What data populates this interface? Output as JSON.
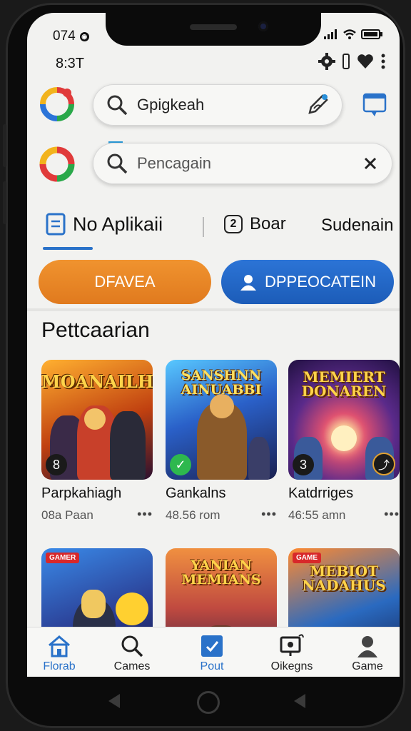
{
  "status_bar": {
    "carrier": "074",
    "time": "8:3T"
  },
  "search": {
    "primary_value": "Gpigkeah",
    "secondary_placeholder": "Pencagain"
  },
  "tabs": [
    {
      "label": "No Aplikaii",
      "active": true
    },
    {
      "label": "Boar",
      "badge": "2"
    },
    {
      "label": "Sudenain"
    }
  ],
  "actions": {
    "left_label": "DFAVEA",
    "right_label": "DPPEOCATEIN"
  },
  "section": {
    "title": "Pettcaarian"
  },
  "cards_row1": [
    {
      "art_title": "MOANAILH",
      "name": "Parpkahiagh",
      "meta": "08a Paan",
      "badge": "8",
      "more": "•••"
    },
    {
      "art_title": "SANSHNN AINUABBI",
      "name": "Gankalns",
      "meta": "48.56 rom",
      "badge": "✓",
      "more": "•••"
    },
    {
      "art_title": "MEMIERT DONAREN",
      "name": "Katdrriges",
      "meta": "46:55 amn",
      "badge": "3",
      "more": "•••"
    }
  ],
  "cards_row2": [
    {
      "tag": "GAMER",
      "art_title": ""
    },
    {
      "art_title": "YANIAN MEMIANS"
    },
    {
      "tag": "GAME",
      "art_title": "MEBIOT NADAHUS"
    }
  ],
  "bottom_nav": [
    {
      "label": "Florab",
      "active": true
    },
    {
      "label": "Cames"
    },
    {
      "label": "Pout"
    },
    {
      "label": "Oikegns"
    },
    {
      "label": "Game"
    }
  ],
  "colors": {
    "accent": "#2a72c9",
    "orange": "#e8862a",
    "blue": "#1f62c0"
  }
}
